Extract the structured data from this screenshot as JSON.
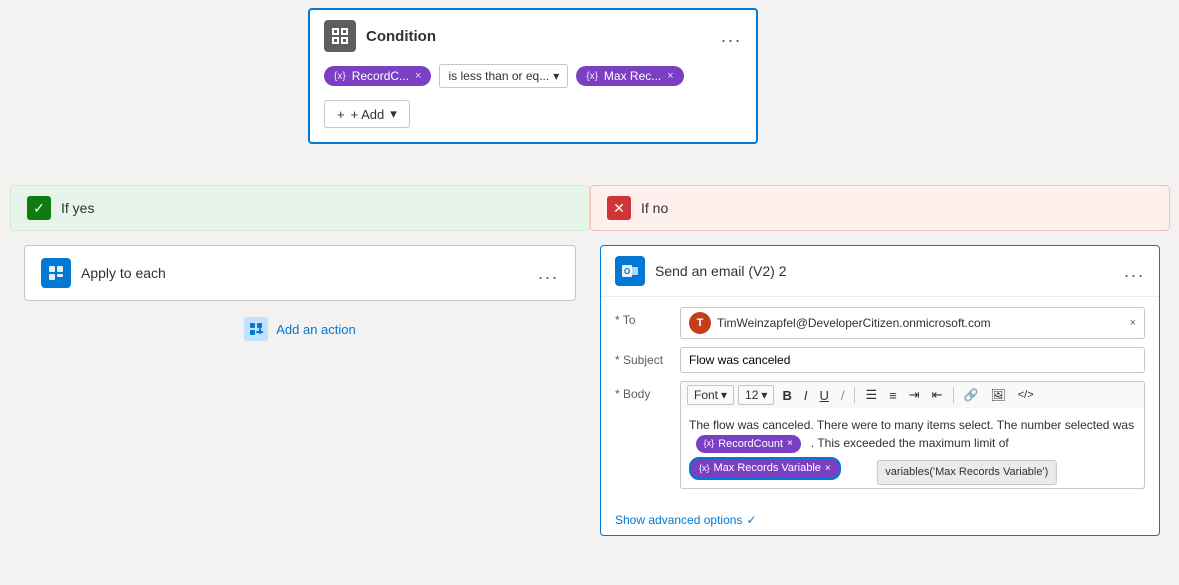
{
  "condition": {
    "title": "Condition",
    "more_options": "...",
    "token1": {
      "label": "RecordC...",
      "icon": "{x}"
    },
    "operator": "is less than or eq...",
    "token2": {
      "label": "Max Rec...",
      "icon": "{x}"
    },
    "add_button": "+ Add"
  },
  "if_yes": {
    "label": "If yes"
  },
  "apply_each": {
    "title": "Apply to each",
    "more_options": "...",
    "add_action": "Add an action"
  },
  "if_no": {
    "label": "If no"
  },
  "send_email": {
    "title": "Send an email (V2) 2",
    "more_options": "...",
    "to_label": "* To",
    "to_email": "TimWeinzapfel@DeveloperCitizen.onmicrosoft.com",
    "to_avatar": "T",
    "subject_label": "* Subject",
    "subject_value": "Flow was canceled",
    "body_label": "* Body",
    "body_font": "Font",
    "body_size": "12",
    "body_text1": "The flow was canceled. There were to many items select. The number selected was",
    "body_token1": "RecordCount",
    "body_text2": ". This exceeded the maximum limit of",
    "body_token2": "Max Records Variable",
    "tooltip": "variables('Max Records Variable')",
    "show_advanced": "Show advanced options"
  },
  "icons": {
    "condition_icon": "⊞",
    "apply_icon": "⊡",
    "outlook_icon": "◎",
    "check": "✓",
    "x_mark": "✕",
    "plus": "+",
    "chevron_down": "▾",
    "bold": "B",
    "italic": "I",
    "underline": "U",
    "strikethrough": "S̶",
    "slash": "/",
    "list_ul": "☰",
    "list_ol": "≡",
    "indent": "⇥",
    "outdent": "⇤",
    "link": "🔗",
    "image": "🖼",
    "code": "</>",
    "remove": "✕"
  }
}
